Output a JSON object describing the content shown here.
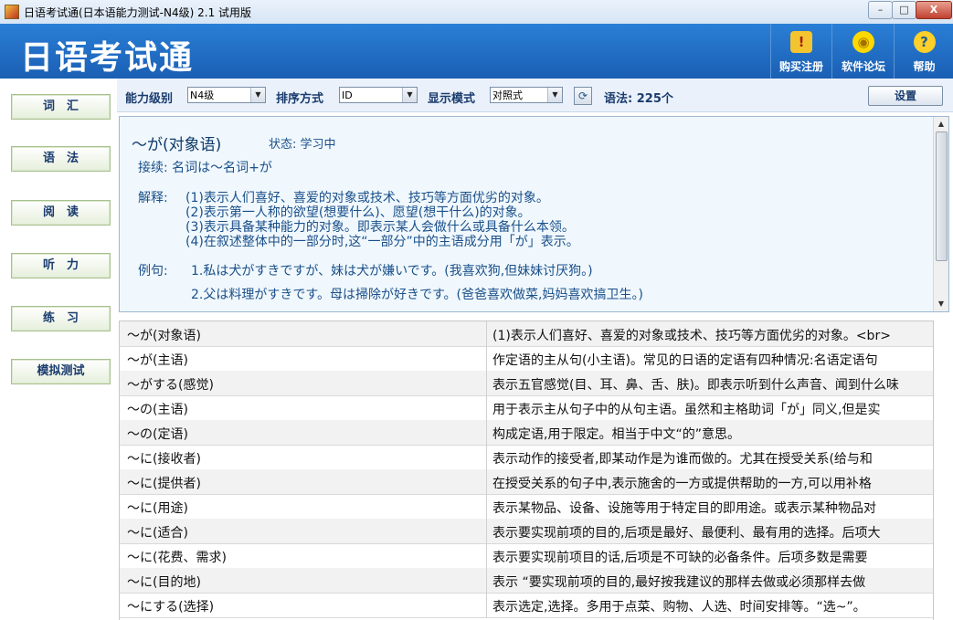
{
  "window": {
    "title": "日语考试通(日本语能力测试-N4级) 2.1 试用版",
    "minimize_label": "–",
    "maximize_label": "□",
    "close_label": "X"
  },
  "header": {
    "logo": "日语考试通",
    "buttons": [
      {
        "icon": "register-icon",
        "glyph": "!",
        "label": "购买注册"
      },
      {
        "icon": "lightbulb-icon",
        "glyph": "◉",
        "label": "软件论坛"
      },
      {
        "icon": "help-icon",
        "glyph": "?",
        "label": "帮助"
      }
    ]
  },
  "nav": {
    "items": [
      {
        "label": "词　汇"
      },
      {
        "label": "语　法"
      },
      {
        "label": "阅　读"
      },
      {
        "label": "听　力"
      },
      {
        "label": "练　习"
      },
      {
        "label": "模拟测试"
      }
    ]
  },
  "toolbar": {
    "level_label": "能力级别",
    "level_value": "N4级",
    "sort_label": "排序方式",
    "sort_value": "ID",
    "display_label": "显示模式",
    "display_value": "对照式",
    "refresh_glyph": "⟳",
    "count_text": "语法: 225个",
    "settings_label": "设置"
  },
  "detail": {
    "title": "～が(对象语)",
    "status": "状态: 学习中",
    "connect": "接续: 名词は～名词+が",
    "explain_label": "解释:",
    "explain_lines": [
      "(1)表示人们喜好、喜爱的对象或技术、技巧等方面优劣的对象。",
      "(2)表示第一人称的欲望(想要什么)、愿望(想干什么)的对象。",
      "(3)表示具备某种能力的对象。即表示某人会做什么或具备什么本领。",
      "(4)在叙述整体中的一部分时,这“一部分”中的主语成分用「が」表示。"
    ],
    "example_label": "例句:",
    "examples": [
      "1.私は犬がすきですが、妹は犬が嫌いです。(我喜欢狗,但妹妹讨厌狗。)",
      "2.父は料理がすきです。母は掃除が好きです。(爸爸喜欢做菜,妈妈喜欢搞卫生。)"
    ]
  },
  "grammar_table": {
    "rows": [
      {
        "name": "～が(对象语)",
        "desc": "(1)表示人们喜好、喜爱的对象或技术、技巧等方面优劣的对象。<br>"
      },
      {
        "name": "～が(主语)",
        "desc": "作定语的主从句(小主语)。常见的日语的定语有四种情况:名语定语句"
      },
      {
        "name": "～がする(感觉)",
        "desc": "表示五官感觉(目、耳、鼻、舌、肤)。即表示听到什么声音、闻到什么味"
      },
      {
        "name": "～の(主语)",
        "desc": "用于表示主从句子中的从句主语。虽然和主格助词「が」同义,但是实"
      },
      {
        "name": "～の(定语)",
        "desc": "构成定语,用于限定。相当于中文“的”意思。"
      },
      {
        "name": "～に(接收者)",
        "desc": "表示动作的接受者,即某动作是为谁而做的。尤其在授受关系(给与和"
      },
      {
        "name": "～に(提供者)",
        "desc": "在授受关系的句子中,表示施舍的一方或提供帮助的一方,可以用补格"
      },
      {
        "name": "～に(用途)",
        "desc": "表示某物品、设备、设施等用于特定目的即用途。或表示某种物品对"
      },
      {
        "name": "～に(适合)",
        "desc": "表示要实现前项的目的,后项是最好、最便利、最有用的选择。后项大"
      },
      {
        "name": "～に(花费、需求)",
        "desc": "表示要实现前项目的话,后项是不可缺的必备条件。后项多数是需要"
      },
      {
        "name": "～に(目的地)",
        "desc": "表示 “要实现前项的目的,最好按我建议的那样去做或必须那样去做"
      },
      {
        "name": "～にする(选择)",
        "desc": "表示选定,选择。多用于点菜、购物、人选、时间安排等。“选~”。"
      }
    ]
  }
}
